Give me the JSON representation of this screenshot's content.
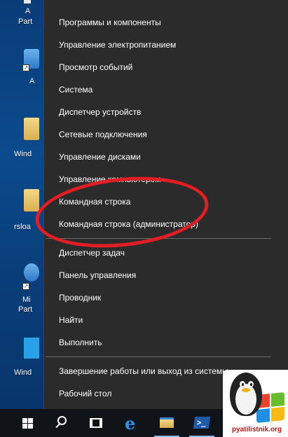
{
  "desktop": {
    "icons": [
      {
        "label": "A",
        "label2": "Part"
      },
      {
        "label": "A"
      },
      {
        "label": "Wind"
      },
      {
        "label": "rsloa"
      },
      {
        "label": "Mi",
        "label2": "Part"
      },
      {
        "label": "Wind"
      }
    ]
  },
  "menu": {
    "items": [
      "Программы и компоненты",
      "Управление электропитанием",
      "Просмотр событий",
      "Система",
      "Диспетчер устройств",
      "Сетевые подключения",
      "Управление дисками",
      "Управление компьютером",
      "Командная строка",
      "Командная строка (администратор)",
      "Диспетчер задач",
      "Панель управления",
      "Проводник",
      "Найти",
      "Выполнить",
      "Завершение работы или выход из системы",
      "Рабочий стол"
    ],
    "submenu_chevron": "›"
  },
  "annotation": {
    "color": "#e01e23"
  },
  "taskbar": {
    "icons": [
      "windows-start-icon",
      "search-icon",
      "task-view-icon",
      "edge-icon",
      "file-explorer-icon",
      "powershell-icon"
    ],
    "ps_glyph": ">_"
  },
  "watermark": {
    "text": "pyatilistnik.org"
  }
}
